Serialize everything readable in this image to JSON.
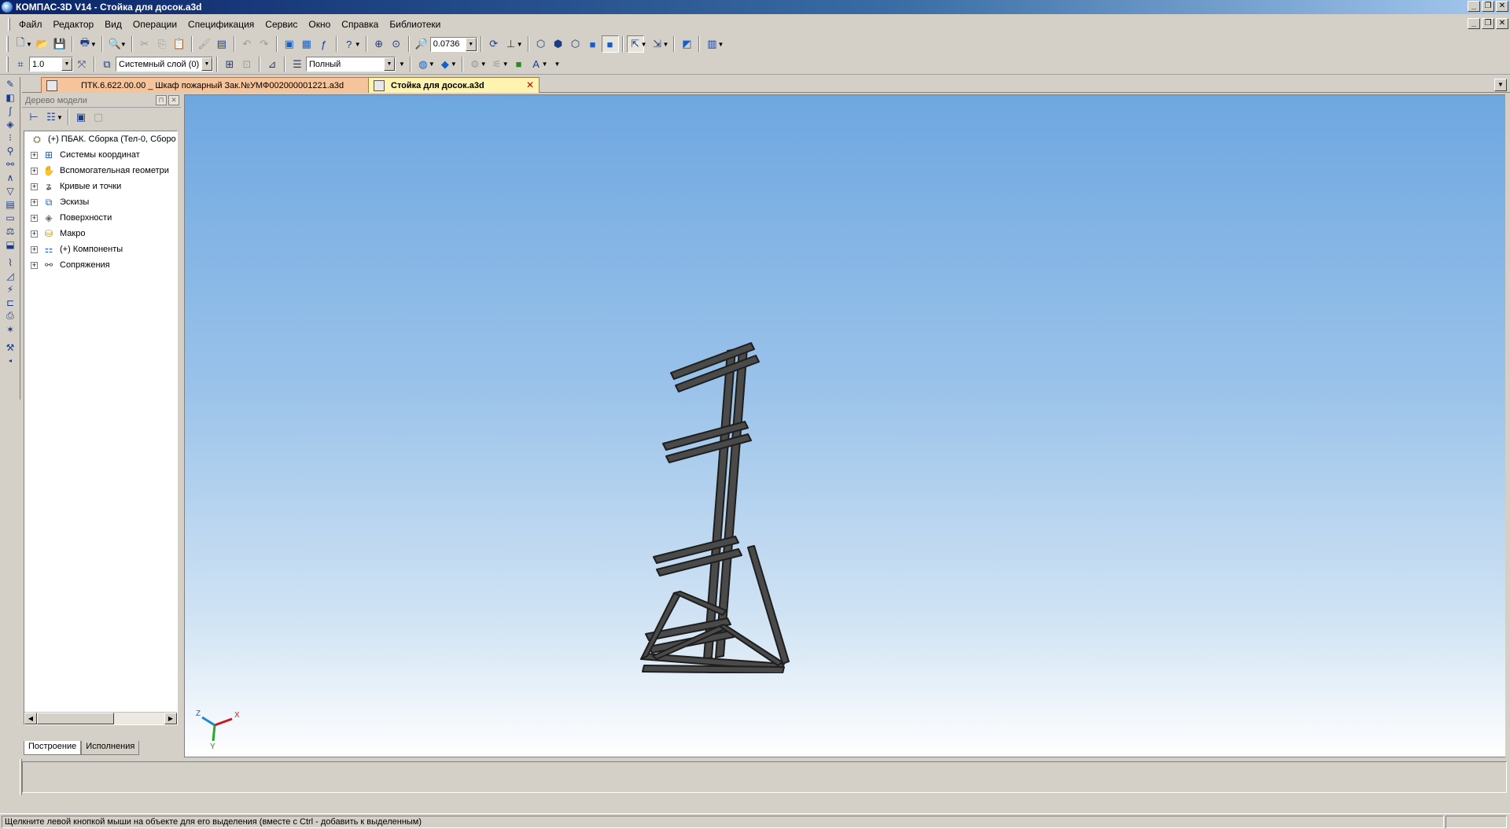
{
  "window": {
    "title": "КОМПАС-3D V14 - Стойка для досок.a3d",
    "minimize": "_",
    "restore": "❐",
    "close": "✕"
  },
  "menu": {
    "items": [
      {
        "label": "Файл"
      },
      {
        "label": "Редактор"
      },
      {
        "label": "Вид"
      },
      {
        "label": "Операции"
      },
      {
        "label": "Спецификация"
      },
      {
        "label": "Сервис"
      },
      {
        "label": "Окно"
      },
      {
        "label": "Справка"
      },
      {
        "label": "Библиотеки"
      }
    ]
  },
  "toolbar": {
    "zoom_value": "0.0736",
    "step_value": "1.0",
    "layer_value": "Системный слой (0)",
    "style_value": "Полный"
  },
  "tabs": [
    {
      "label": "ПТК.6.622.00.00 _ Шкаф пожарный Зак.№УМФ002000001221.a3d",
      "active": false
    },
    {
      "label": "Стойка для досок.a3d",
      "active": true
    }
  ],
  "tree_panel": {
    "title": "Дерево модели",
    "root": "(+) ПБАК. Сборка (Тел-0, Сборо",
    "items": [
      {
        "label": "Системы координат",
        "icon": "coordinate-systems-icon"
      },
      {
        "label": "Вспомогательная геометри",
        "icon": "aux-geometry-icon"
      },
      {
        "label": "Кривые и точки",
        "icon": "curves-icon"
      },
      {
        "label": "Эскизы",
        "icon": "sketch-icon"
      },
      {
        "label": "Поверхности",
        "icon": "surfaces-icon"
      },
      {
        "label": "Макро",
        "icon": "macro-icon"
      },
      {
        "label": "(+) Компоненты",
        "icon": "components-icon"
      },
      {
        "label": "Сопряжения",
        "icon": "mates-icon"
      }
    ],
    "bottom_tabs": [
      {
        "label": "Построение",
        "active": true
      },
      {
        "label": "Исполнения",
        "active": false
      }
    ]
  },
  "triad": {
    "x_label": "X",
    "y_label": "Y",
    "z_label": "Z"
  },
  "status": {
    "message": "Щелкните левой кнопкой мыши на объекте для его выделения (вместе с Ctrl - добавить к выделенным)"
  },
  "colors": {
    "title_bar": "#0a246a",
    "viewport_top": "#6ea7e0",
    "viewport_bottom": "#ffffff",
    "model_steel": "#4a4a4a",
    "active_tab": "#fff3b0",
    "inactive_tab": "#f5c49a"
  }
}
